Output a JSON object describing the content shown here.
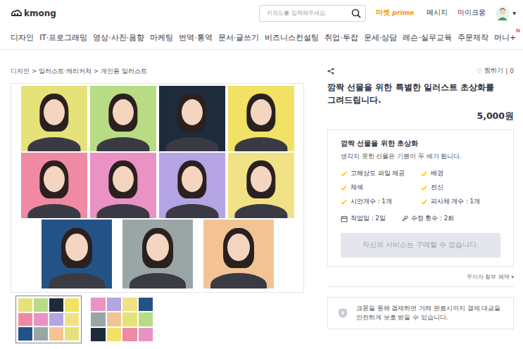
{
  "header": {
    "logo": "kmong",
    "search": {
      "placeholder": "키워드를 입력해주세요."
    },
    "market": {
      "label": "마켓",
      "badge": "prime"
    },
    "links": [
      "메시지",
      "마이크몽"
    ],
    "avatar_caret": "▾"
  },
  "nav": [
    {
      "label": "디자인"
    },
    {
      "label": "IT·프로그래밍"
    },
    {
      "label": "영상·사진·음향"
    },
    {
      "label": "마케팅"
    },
    {
      "label": "번역·통역"
    },
    {
      "label": "문서·글쓰기"
    },
    {
      "label": "비즈니스컨설팅"
    },
    {
      "label": "취업·투잡"
    },
    {
      "label": "운세·상담"
    },
    {
      "label": "레슨·실무교육"
    },
    {
      "label": "주문제작"
    },
    {
      "label": "머니+",
      "badge": "N"
    }
  ],
  "breadcrumb": {
    "items": [
      "디자인",
      "일러스트·캐리커쳐",
      "개인용 일러스트"
    ],
    "separator": ">"
  },
  "gallery": {
    "tiles": [
      {
        "color": "#e6e27a"
      },
      {
        "color": "#b7dc84"
      },
      {
        "color": "#1d2b3a"
      },
      {
        "color": "#f1e266"
      },
      {
        "color": "#f08aa4"
      },
      {
        "color": "#ea92c4"
      },
      {
        "color": "#b4a4e4"
      },
      {
        "color": "#f0e284"
      },
      {
        "color": "#235386"
      },
      {
        "color": "#9aa6a6"
      },
      {
        "color": "#f2c494"
      }
    ],
    "thumbnails": [
      {
        "selected": true
      },
      {
        "selected": false
      }
    ]
  },
  "product": {
    "wish": {
      "icon": "♡",
      "label": "찜하기",
      "separator": "|",
      "count": "0"
    },
    "title": "깜짝 선물을 위한 특별한 일러스트 초상화를 그려드립니다.",
    "price": "5,000원"
  },
  "package": {
    "title": "깜짝 선물을 위한 초상화",
    "description": "생각지 못한 선물은 기쁨이 두 배가 됩니다.",
    "features": [
      "고해상도 파일 제공",
      "배경",
      "채색",
      "전신",
      "시안개수 : 1개",
      "피사체 개수 : 1개"
    ],
    "work_days": "작업일 : 2일",
    "revisions": "수정 횟수 : 2회",
    "button": {
      "label": "자신의 서비스는 구매할 수 없습니다.",
      "disabled": true
    }
  },
  "installment": {
    "label": "무이자 할부 혜택",
    "icon": "▾"
  },
  "safety": {
    "text": "크몽을 통해 결제하면 거래 완료시까지 결제 대금을 안전하게 보호 받을 수 있습니다."
  }
}
